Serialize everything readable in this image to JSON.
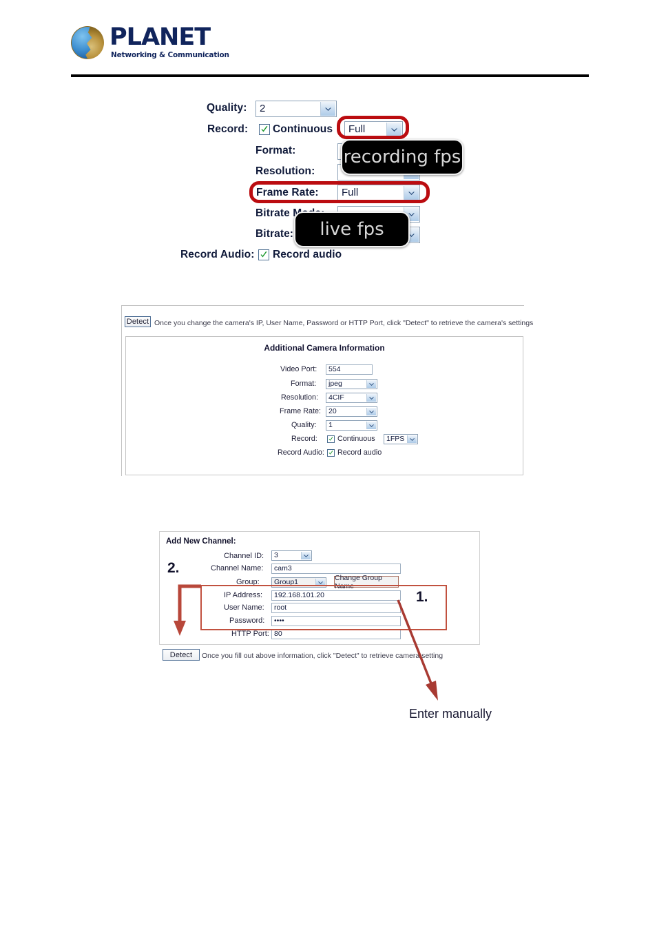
{
  "header": {
    "logo_wordmark": "PLANET",
    "logo_tagline": "Networking & Communication",
    "logo_icon": "globe-icon"
  },
  "section1": {
    "name": "camera-stream-settings-top",
    "rows": [
      {
        "label": "Quality:",
        "control": "select",
        "value": "2"
      },
      {
        "label": "Record:",
        "control": "checkbox-select",
        "checkbox_label": "Continuous",
        "checked": true,
        "value": "Full"
      },
      {
        "label": "Format:",
        "control": "select",
        "value": ""
      },
      {
        "label": "Resolution:",
        "control": "select",
        "value": ""
      },
      {
        "label": "Frame Rate:",
        "control": "select",
        "value": "Full"
      },
      {
        "label": "Bitrate Mode:",
        "control": "select",
        "value": ""
      },
      {
        "label": "Bitrate:",
        "control": "select",
        "value": ""
      },
      {
        "label": "Record Audio:",
        "control": "checkbox",
        "checkbox_label": "Record audio",
        "checked": true
      }
    ],
    "callouts": [
      {
        "text": "recording fps",
        "highlights": "Record continuous fps dropdown"
      },
      {
        "text": "live fps",
        "highlights": "Frame Rate dropdown"
      }
    ],
    "highlight_color": "#bb0c10"
  },
  "section2": {
    "detect_button": "Detect",
    "detect_hint": "Once you change the camera's IP, User Name, Password or HTTP Port, click \"Detect\" to retrieve the camera's settings",
    "panel_title": "Additional Camera Information",
    "fields": [
      {
        "label": "Video Port:",
        "control": "text",
        "value": "554"
      },
      {
        "label": "Format:",
        "control": "select",
        "value": "jpeg"
      },
      {
        "label": "Resolution:",
        "control": "select",
        "value": "4CIF"
      },
      {
        "label": "Frame Rate:",
        "control": "select",
        "value": "20"
      },
      {
        "label": "Quality:",
        "control": "select",
        "value": "1"
      },
      {
        "label": "Record:",
        "control": "checkbox-select",
        "checkbox_label": "Continuous",
        "checked": true,
        "value": "1FPS"
      },
      {
        "label": "Record Audio:",
        "control": "checkbox",
        "checkbox_label": "Record audio",
        "checked": true
      }
    ]
  },
  "section3": {
    "heading": "Add New Channel:",
    "step_two": "2.",
    "step_one": "1.",
    "fields": [
      {
        "label": "Channel ID:",
        "control": "select",
        "value": "3"
      },
      {
        "label": "Channel Name:",
        "control": "text",
        "value": "cam3"
      },
      {
        "label": "Group:",
        "control": "select",
        "value": "Group1"
      },
      {
        "label": "IP Address:",
        "control": "text",
        "value": "192.168.101.20"
      },
      {
        "label": "User Name:",
        "control": "text",
        "value": "root"
      },
      {
        "label": "Password:",
        "control": "text",
        "value": "••••"
      },
      {
        "label": "HTTP Port:",
        "control": "text",
        "value": "80"
      }
    ],
    "change_group_button": "Change Group Name",
    "detect_button": "Detect",
    "detect_hint": "Once you fill out above information, click \"Detect\" to retrieve camera setting",
    "enter_manually_label": "Enter manually",
    "annotation_color": "#a83a32"
  }
}
